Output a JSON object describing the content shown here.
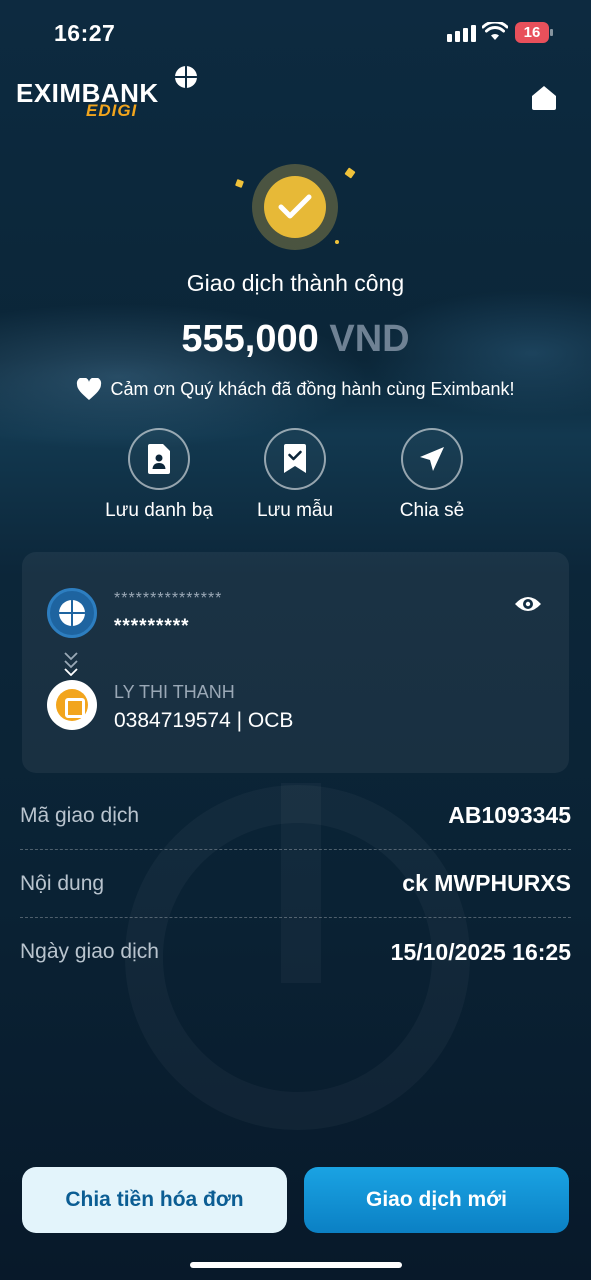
{
  "status_bar": {
    "time": "16:27",
    "battery": "16"
  },
  "header": {
    "brand": "EXIMBANK",
    "sub_brand": "EDIGI"
  },
  "result": {
    "title": "Giao dịch thành công",
    "amount": "555,000",
    "currency": "VND",
    "thanks": "Cảm ơn Quý khách đã đồng hành cùng Eximbank!"
  },
  "actions": [
    {
      "label": "Lưu danh bạ",
      "icon": "contact-file-icon"
    },
    {
      "label": "Lưu mẫu",
      "icon": "bookmark-check-icon"
    },
    {
      "label": "Chia sẻ",
      "icon": "send-icon"
    }
  ],
  "transfer": {
    "from_name": "***************",
    "from_account": "*********",
    "to_name": "LY THI THANH",
    "to_account": "0384719574 | OCB"
  },
  "details": [
    {
      "label": "Mã giao dịch",
      "value": "AB1093345"
    },
    {
      "label": "Nội dung",
      "value": "ck MWPHURXS"
    },
    {
      "label": "Ngày giao dịch",
      "value": "15/10/2025 16:25"
    }
  ],
  "buttons": {
    "split_bill": "Chia tiền hóa đơn",
    "new_transaction": "Giao dịch mới"
  },
  "colors": {
    "accent": "#1aa3e3",
    "success": "#e7b937",
    "brand_orange": "#f2a51d"
  }
}
